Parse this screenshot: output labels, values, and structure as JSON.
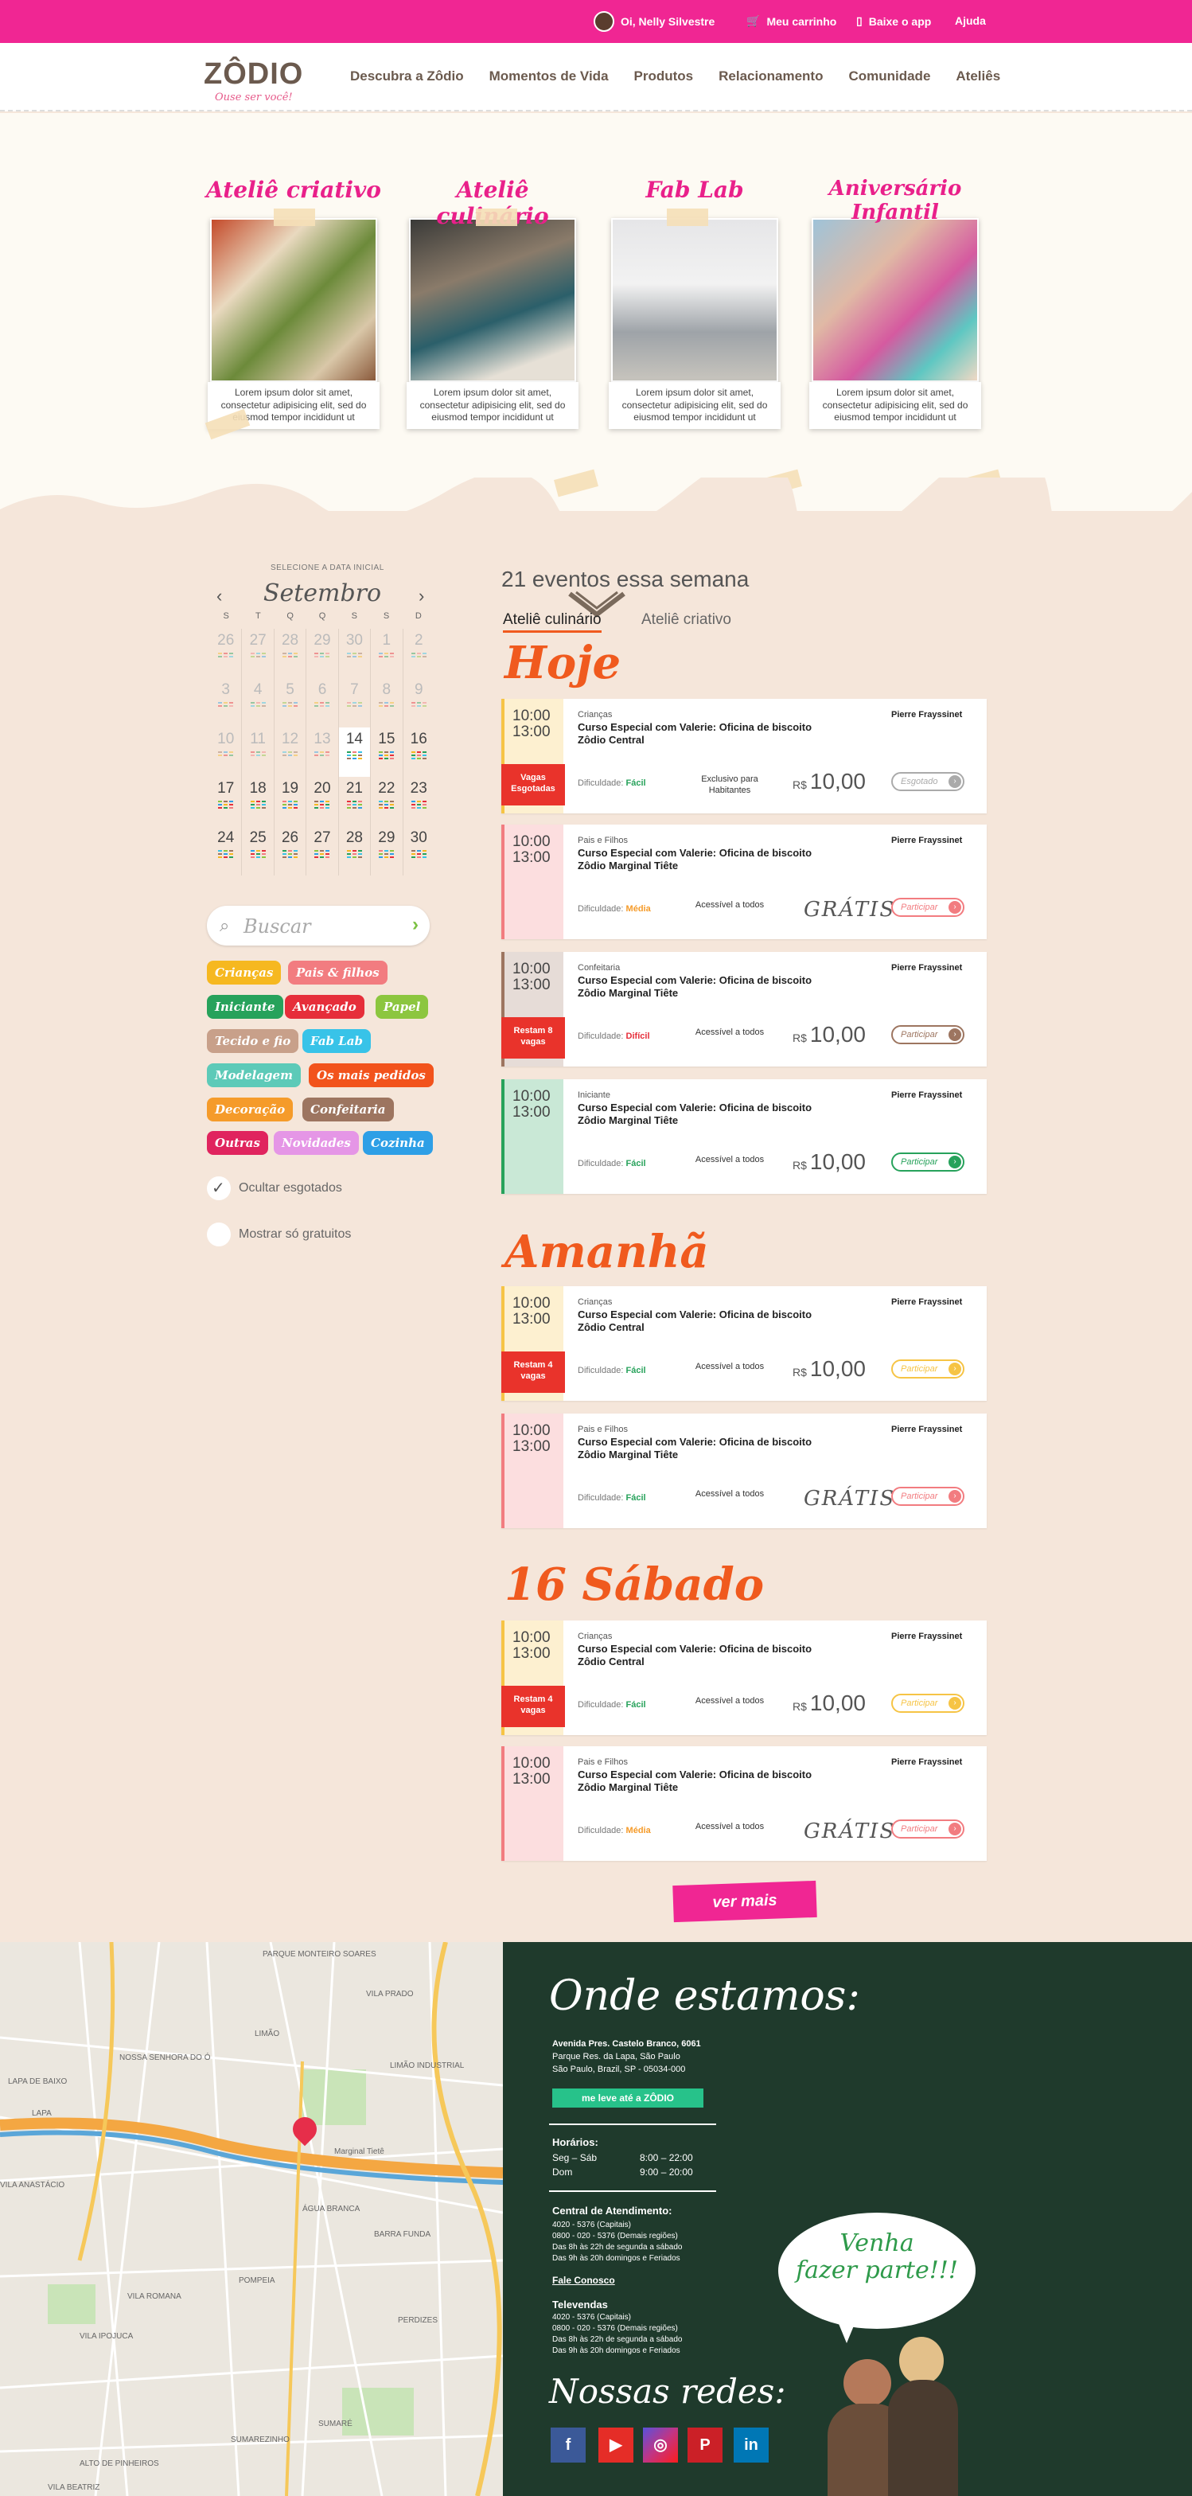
{
  "topbar": {
    "greeting": "Oi, Nelly Silvestre",
    "cart": "Meu carrinho",
    "app": "Baixe o app",
    "help": "Ajuda"
  },
  "logo": {
    "word": "ZÔDIO",
    "slogan": "Ouse ser você!"
  },
  "nav": [
    "Descubra a Zôdio",
    "Momentos de Vida",
    "Produtos",
    "Relacionamento",
    "Comunidade",
    "Ateliês"
  ],
  "hero": {
    "cards": [
      {
        "title": "Ateliê criativo",
        "text": "Lorem ipsum dolor sit amet, consectetur adipisicing elit, sed do eiusmod tempor incididunt ut"
      },
      {
        "title": "Ateliê culinário",
        "text": "Lorem ipsum dolor sit amet, consectetur adipisicing elit, sed do eiusmod tempor incididunt ut"
      },
      {
        "title": "Fab Lab",
        "text": "Lorem ipsum dolor sit amet, consectetur adipisicing elit, sed do eiusmod tempor incididunt ut"
      },
      {
        "title": "Aniversário Infantil",
        "text": "Lorem ipsum dolor sit amet, consectetur adipisicing elit, sed do eiusmod tempor incididunt ut"
      }
    ]
  },
  "calendar": {
    "heading": "SELECIONE A DATA INICIAL",
    "month": "Setembro",
    "prev": "‹",
    "next": "›",
    "dow": [
      "S",
      "T",
      "Q",
      "Q",
      "S",
      "S",
      "D"
    ],
    "weeks": [
      [
        "26",
        "27",
        "28",
        "29",
        "30",
        "1",
        "2"
      ],
      [
        "3",
        "4",
        "5",
        "6",
        "7",
        "8",
        "9"
      ],
      [
        "10",
        "11",
        "12",
        "13",
        "14",
        "15",
        "16"
      ],
      [
        "17",
        "18",
        "19",
        "20",
        "21",
        "22",
        "23"
      ],
      [
        "24",
        "25",
        "26",
        "27",
        "28",
        "29",
        "30"
      ]
    ]
  },
  "search": {
    "placeholder": "Buscar"
  },
  "tags": [
    {
      "label": "Crianças",
      "color": "#f6b820"
    },
    {
      "label": "Pais & filhos",
      "color": "#f27c80"
    },
    {
      "label": "Iniciante",
      "color": "#27a25b"
    },
    {
      "label": "Avançado",
      "color": "#e62e3a"
    },
    {
      "label": "Papel",
      "color": "#8cc63f"
    },
    {
      "label": "Tecido e fio",
      "color": "#c8a08a"
    },
    {
      "label": "Fab Lab",
      "color": "#38c3e8"
    },
    {
      "label": "Modelagem",
      "color": "#5dcab8"
    },
    {
      "label": "Os mais pedidos",
      "color": "#f2531c"
    },
    {
      "label": "Decoração",
      "color": "#f59b2a"
    },
    {
      "label": "Confeitaria",
      "color": "#9d7560"
    },
    {
      "label": "Outras",
      "color": "#e0245e"
    },
    {
      "label": "Novidades",
      "color": "#e596e6"
    },
    {
      "label": "Cozinha",
      "color": "#2e9fe6"
    }
  ],
  "filters": {
    "hide_soldout": "Ocultar esgotados",
    "only_free": "Mostrar só gratuitos"
  },
  "events": {
    "count_text": "21 eventos essa semana",
    "tab_active": "Ateliê culinário",
    "tab_other": "Ateliê criativo",
    "days": [
      {
        "title": "Hoje",
        "items": [
          {
            "time1": "10:00",
            "time2": "13:00",
            "category": "Crianças",
            "name": "Curso Especial com Valerie: Oficina de biscoito",
            "place": "Zôdio Central",
            "author": "Pierre Frayssinet",
            "difficulty_label": "Dificuldade:",
            "difficulty": "Fácil",
            "access": "Exclusivo para Habitantes",
            "currency": "R$",
            "price": "10,00",
            "button": "Esgotado",
            "badge": "Vagas Esgotadas",
            "color": "#f6c445"
          },
          {
            "time1": "10:00",
            "time2": "13:00",
            "category": "Pais e Filhos",
            "name": "Curso Especial com Valerie: Oficina de biscoito",
            "place": "Zôdio Marginal Tiête",
            "author": "Pierre Frayssinet",
            "difficulty_label": "Dificuldade:",
            "difficulty": "Média",
            "access": "Acessível a todos",
            "currency": "",
            "price": "GRÁTIS",
            "button": "Participar",
            "badge": "",
            "color": "#f27c80"
          },
          {
            "time1": "10:00",
            "time2": "13:00",
            "category": "Confeitaria",
            "name": "Curso Especial com Valerie: Oficina de biscoito",
            "place": "Zôdio Marginal Tiête",
            "author": "Pierre Frayssinet",
            "difficulty_label": "Dificuldade:",
            "difficulty": "Difícil",
            "access": "Acessível a todos",
            "currency": "R$",
            "price": "10,00",
            "button": "Participar",
            "badge": "Restam 8 vagas",
            "color": "#9d7560"
          },
          {
            "time1": "10:00",
            "time2": "13:00",
            "category": "Iniciante",
            "name": "Curso Especial com Valerie: Oficina de biscoito",
            "place": "Zôdio Marginal Tiête",
            "author": "Pierre Frayssinet",
            "difficulty_label": "Dificuldade:",
            "difficulty": "Fácil",
            "access": "Acessível a todos",
            "currency": "R$",
            "price": "10,00",
            "button": "Participar",
            "badge": "",
            "color": "#27a25b"
          }
        ]
      },
      {
        "title": "Amanhã",
        "items": [
          {
            "time1": "10:00",
            "time2": "13:00",
            "category": "Crianças",
            "name": "Curso Especial com Valerie: Oficina de biscoito",
            "place": "Zôdio Central",
            "author": "Pierre Frayssinet",
            "difficulty_label": "Dificuldade:",
            "difficulty": "Fácil",
            "access": "Acessível a todos",
            "currency": "R$",
            "price": "10,00",
            "button": "Participar",
            "badge": "Restam 4 vagas",
            "color": "#f6c445"
          },
          {
            "time1": "10:00",
            "time2": "13:00",
            "category": "Pais e Filhos",
            "name": "Curso Especial com Valerie: Oficina de biscoito",
            "place": "Zôdio Marginal Tiête",
            "author": "Pierre Frayssinet",
            "difficulty_label": "Dificuldade:",
            "difficulty": "Fácil",
            "access": "Acessível a todos",
            "currency": "",
            "price": "GRÁTIS",
            "button": "Participar",
            "badge": "",
            "color": "#f27c80"
          }
        ]
      },
      {
        "title": "16 Sábado",
        "items": [
          {
            "time1": "10:00",
            "time2": "13:00",
            "category": "Crianças",
            "name": "Curso Especial com Valerie: Oficina de biscoito",
            "place": "Zôdio Central",
            "author": "Pierre Frayssinet",
            "difficulty_label": "Dificuldade:",
            "difficulty": "Fácil",
            "access": "Acessível a todos",
            "currency": "R$",
            "price": "10,00",
            "button": "Participar",
            "badge": "Restam 4 vagas",
            "color": "#f6c445"
          },
          {
            "time1": "10:00",
            "time2": "13:00",
            "category": "Pais e Filhos",
            "name": "Curso Especial com Valerie: Oficina de biscoito",
            "place": "Zôdio Marginal Tiête",
            "author": "Pierre Frayssinet",
            "difficulty_label": "Dificuldade:",
            "difficulty": "Média",
            "access": "Acessível a todos",
            "currency": "",
            "price": "GRÁTIS",
            "button": "Participar",
            "badge": "",
            "color": "#f27c80"
          }
        ]
      }
    ],
    "more": "ver mais"
  },
  "map_labels": [
    "PARQUE MONTEIRO SOARES",
    "VILA PRADO",
    "LIMÃO",
    "NOSSA SENHORA DO Ó",
    "LIMÃO INDUSTRIAL",
    "LAPA",
    "VILA ANASTÁCIO",
    "ÁGUA BRANCA",
    "BARRA FUNDA",
    "VILA ROMANA",
    "POMPEIA",
    "PERDIZES",
    "VILA IPOJUCA",
    "SUMAREZINHO",
    "ALTO DE PINHEIROS",
    "VILA BEATRIZ",
    "SUMARÉ",
    "LAPA DE BAIXO",
    "Marginal Tietê"
  ],
  "footer": {
    "title": "Onde estamos:",
    "address": [
      "Avenida Pres. Castelo Branco, 6061",
      "Parque Res. da Lapa, São Paulo",
      "São Paulo, Brazil, SP - 05034-000"
    ],
    "cta": "me leve até a ZÔDIO",
    "hours_title": "Horários:",
    "hours": [
      {
        "day": "Seg – Sáb",
        "time": "8:00 – 22:00"
      },
      {
        "day": "Dom",
        "time": "9:00 – 20:00"
      }
    ],
    "service_title": "Central de Atendimento:",
    "service": [
      "4020 - 5376 (Capitais)",
      "0800 - 020 - 5376 (Demais regiões)",
      "Das 8h às 22h de segunda a sábado",
      "Das 9h às 20h domingos e Feriados"
    ],
    "contact": "Fale Conosco",
    "tv_title": "Televendas",
    "tv": [
      "4020 - 5376 (Capitais)",
      "0800 - 020 - 5376 (Demais regiões)",
      "Das 8h às 22h de segunda a sábado",
      "Das 9h às 20h domingos e Feriados"
    ],
    "bubble": [
      "Venha",
      "fazer parte!!!"
    ],
    "social_title": "Nossas redes:",
    "social": [
      {
        "label": "f",
        "icon": "facebook-icon",
        "color": "#3b5998"
      },
      {
        "label": "▶",
        "icon": "youtube-icon",
        "color": "#e52d27"
      },
      {
        "label": "◎",
        "icon": "instagram-icon",
        "color": "#c13584"
      },
      {
        "label": "P",
        "icon": "pinterest-icon",
        "color": "#cb2027"
      },
      {
        "label": "in",
        "icon": "linkedin-icon",
        "color": "#0077b5"
      }
    ]
  }
}
